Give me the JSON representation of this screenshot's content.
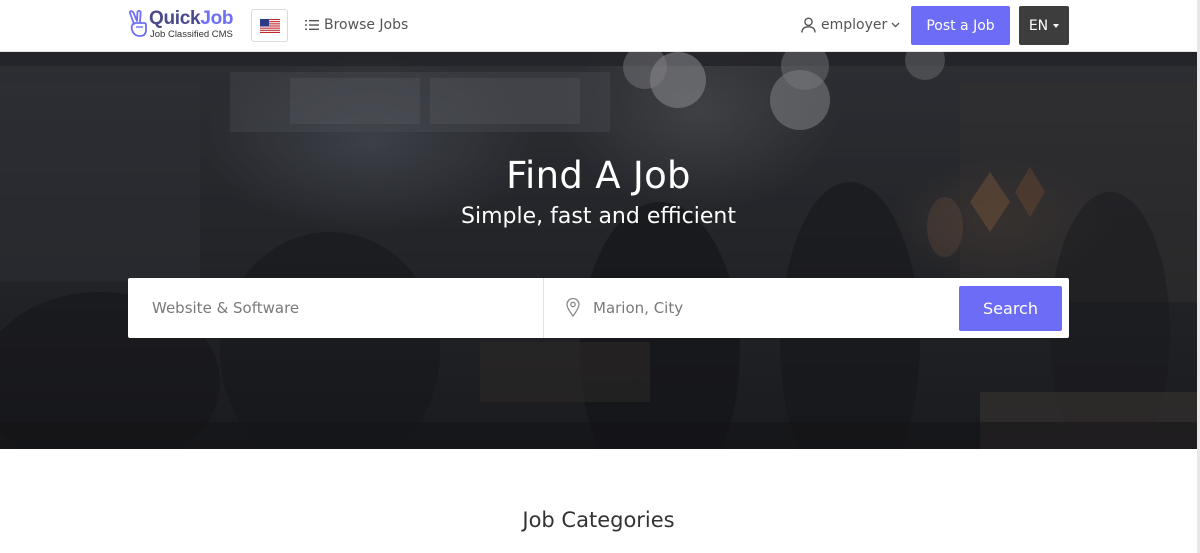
{
  "header": {
    "logo": {
      "title_part1": "Quick",
      "title_part2": "Job",
      "subtitle": "Job Classified CMS"
    },
    "flag": "us-flag-icon",
    "browse_label": "Browse Jobs",
    "user_label": "employer",
    "post_label": "Post a Job",
    "lang_label": "EN"
  },
  "hero": {
    "title": "Find A Job",
    "subtitle": "Simple, fast and efficient",
    "search": {
      "keyword_placeholder": "Website & Software",
      "location_placeholder": "Marion, City",
      "button_label": "Search"
    }
  },
  "categories": {
    "heading": "Job Categories"
  },
  "icons": {
    "logo": "peace-hand-icon",
    "browse": "list-icon",
    "user": "user-icon",
    "dropdown": "chevron-down-icon",
    "location": "map-pin-icon"
  },
  "colors": {
    "accent": "#6c6cf6",
    "dark_button": "#3d3d3d",
    "logo_dark": "#4a4a8c"
  }
}
